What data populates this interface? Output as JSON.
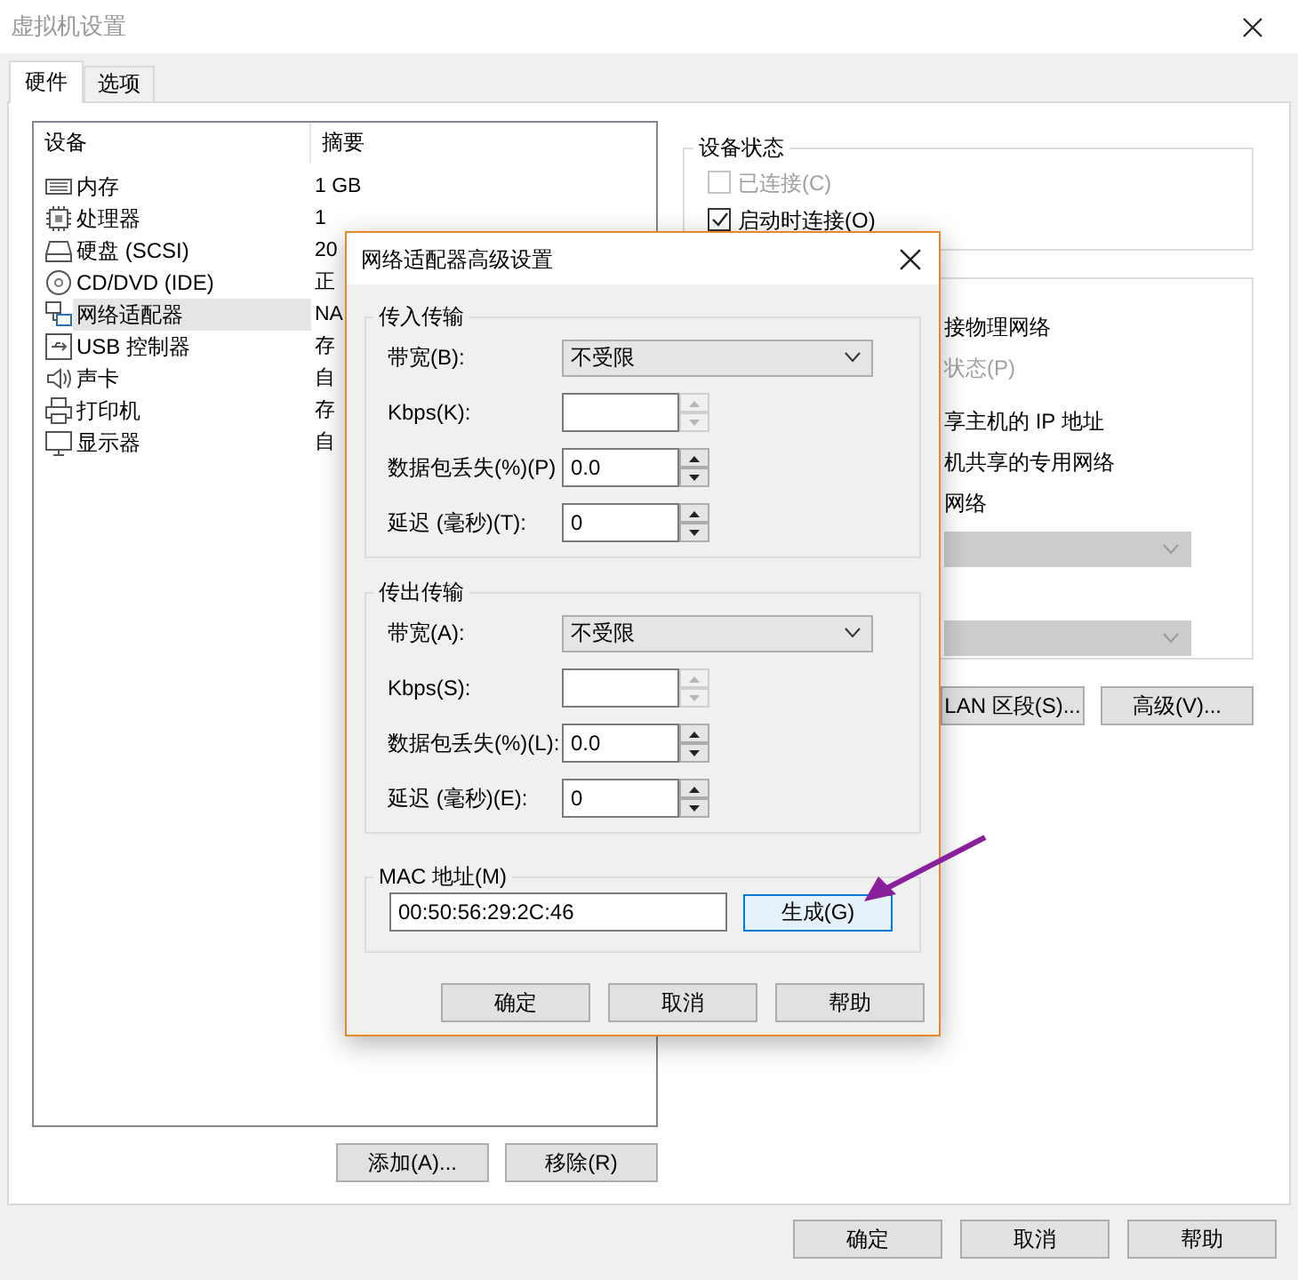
{
  "window": {
    "title": "虚拟机设置"
  },
  "tabs": [
    {
      "label": "硬件",
      "selected": true
    },
    {
      "label": "选项",
      "selected": false
    }
  ],
  "devices": {
    "columns": [
      "设备",
      "摘要"
    ],
    "rows": [
      {
        "kind": "memory",
        "name": "内存",
        "summary": "1 GB",
        "selected": false
      },
      {
        "kind": "cpu",
        "name": "处理器",
        "summary": "1",
        "selected": false
      },
      {
        "kind": "disk",
        "name": "硬盘 (SCSI)",
        "summary": "20",
        "selected": false
      },
      {
        "kind": "cd",
        "name": "CD/DVD (IDE)",
        "summary": "正",
        "selected": false
      },
      {
        "kind": "network",
        "name": "网络适配器",
        "summary": "NA",
        "selected": true
      },
      {
        "kind": "usb",
        "name": "USB 控制器",
        "summary": "存",
        "selected": false
      },
      {
        "kind": "sound",
        "name": "声卡",
        "summary": "自",
        "selected": false
      },
      {
        "kind": "printer",
        "name": "打印机",
        "summary": "存",
        "selected": false
      },
      {
        "kind": "display",
        "name": "显示器",
        "summary": "自",
        "selected": false
      }
    ]
  },
  "device_buttons": [
    "添加(A)...",
    "移除(R)"
  ],
  "device_status": {
    "title": "设备状态",
    "options": [
      {
        "label": "已连接(C)",
        "checked": false,
        "disabled": true
      },
      {
        "label": "启动时连接(O)",
        "checked": true,
        "disabled": false
      }
    ]
  },
  "network_connection": {
    "items": [
      {
        "kind": "text",
        "text": "接物理网络",
        "disabled": false
      },
      {
        "kind": "text",
        "text": "状态(P)",
        "disabled": true
      },
      {
        "kind": "text",
        "text": "享主机的 IP 地址",
        "disabled": false
      },
      {
        "kind": "text",
        "text": "机共享的专用网络",
        "disabled": false
      },
      {
        "kind": "text",
        "text": "网络",
        "disabled": false
      },
      {
        "kind": "dropdown",
        "disabled": true
      },
      {
        "kind": "dropdown",
        "disabled": true
      }
    ]
  },
  "network_buttons": [
    "LAN 区段(S)...",
    "高级(V)..."
  ],
  "dialog": {
    "title": "网络适配器高级设置",
    "groups": [
      {
        "title": "传入传输",
        "fields": [
          {
            "kind": "select",
            "label": "带宽(B):",
            "value": "不受限"
          },
          {
            "kind": "spin",
            "label": "Kbps(K):",
            "arrows_enabled": false
          },
          {
            "kind": "spin",
            "label": "数据包丢失(%)(P)",
            "value": "0.0",
            "arrows_enabled": true
          },
          {
            "kind": "spin",
            "label": "延迟 (毫秒)(T):",
            "value": "0",
            "arrows_enabled": true
          }
        ]
      },
      {
        "title": "传出传输",
        "fields": [
          {
            "kind": "select",
            "label": "带宽(A):",
            "value": "不受限"
          },
          {
            "kind": "spin",
            "label": "Kbps(S):",
            "arrows_enabled": false
          },
          {
            "kind": "spin",
            "label": "数据包丢失(%)(L):",
            "value": "0.0",
            "arrows_enabled": true
          },
          {
            "kind": "spin",
            "label": "延迟 (毫秒)(E):",
            "value": "0",
            "arrows_enabled": true
          }
        ]
      }
    ],
    "mac": {
      "title": "MAC 地址(M)",
      "value": "00:50:56:29:2C:46",
      "button": "生成(G)",
      "button_highlighted": true
    },
    "buttons": [
      "确定",
      "取消",
      "帮助"
    ]
  },
  "buttons": [
    "确定",
    "取消",
    "帮助"
  ]
}
